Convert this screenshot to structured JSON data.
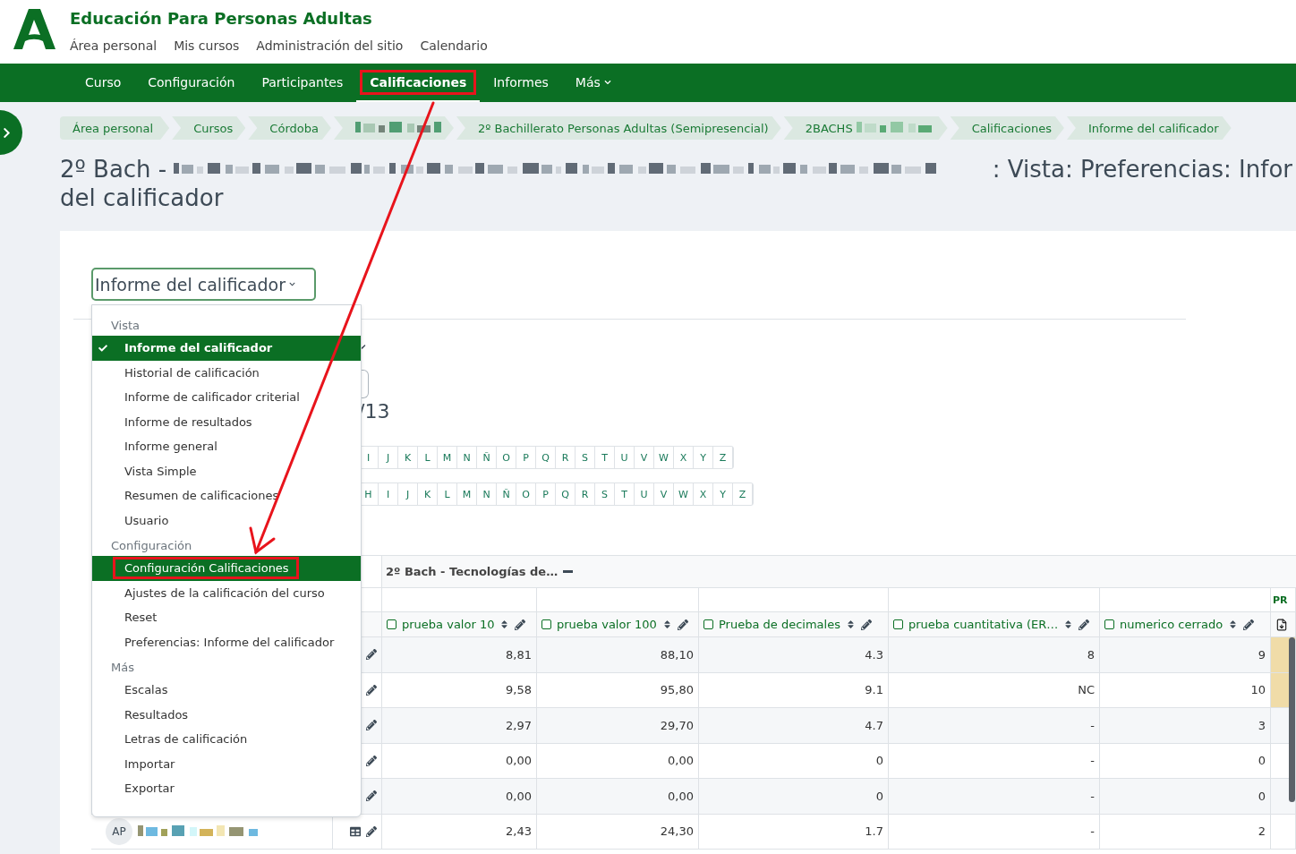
{
  "site": {
    "title": "Educación Para Personas Adultas",
    "nav": [
      "Área personal",
      "Mis cursos",
      "Administración del sitio",
      "Calendario"
    ]
  },
  "course_nav": [
    {
      "label": "Curso",
      "kind": "link",
      "selected": false,
      "highlighted": false
    },
    {
      "label": "Configuración",
      "kind": "link",
      "selected": false,
      "highlighted": false
    },
    {
      "label": "Participantes",
      "kind": "link",
      "selected": false,
      "highlighted": false
    },
    {
      "label": "Calificaciones",
      "kind": "link",
      "selected": true,
      "highlighted": true
    },
    {
      "label": "Informes",
      "kind": "link",
      "selected": false,
      "highlighted": false
    },
    {
      "label": "Más",
      "kind": "menu",
      "selected": false,
      "highlighted": false
    }
  ],
  "breadcrumb": [
    {
      "kind": "text",
      "label": "Área personal"
    },
    {
      "kind": "text",
      "label": "Cursos"
    },
    {
      "kind": "text",
      "label": "Córdoba"
    },
    {
      "kind": "redacted"
    },
    {
      "kind": "text",
      "label": "2º Bachillerato Personas Adultas (Semipresencial)"
    },
    {
      "kind": "partly_redacted",
      "label": "2BACHS"
    },
    {
      "kind": "text",
      "label": "Calificaciones"
    },
    {
      "kind": "text",
      "label": "Informe del calificador"
    }
  ],
  "page_title": {
    "prefix": "2º Bach -",
    "suffix": ": Vista: Preferencias: Infor",
    "line2": "del calificador"
  },
  "report_select": {
    "value": "Informe del calificador",
    "expanded": true
  },
  "menu": [
    {
      "heading": "Vista",
      "items": [
        {
          "label": "Informe del calificador",
          "selected": true,
          "highlighted": false
        },
        {
          "label": "Historial de calificación",
          "selected": false,
          "highlighted": false
        },
        {
          "label": "Informe de calificador criterial",
          "selected": false,
          "highlighted": false
        },
        {
          "label": "Informe de resultados",
          "selected": false,
          "highlighted": false
        },
        {
          "label": "Informe general",
          "selected": false,
          "highlighted": false
        },
        {
          "label": "Vista Simple",
          "selected": false,
          "highlighted": false
        },
        {
          "label": "Resumen de calificaciones",
          "selected": false,
          "highlighted": false
        },
        {
          "label": "Usuario",
          "selected": false,
          "highlighted": false
        }
      ]
    },
    {
      "heading": "Configuración",
      "items": [
        {
          "label": "Configuración Calificaciones",
          "selected": false,
          "highlighted": true
        },
        {
          "label": "Ajustes de la calificación del curso",
          "selected": false,
          "highlighted": false
        },
        {
          "label": "Reset",
          "selected": false,
          "highlighted": false
        },
        {
          "label": "Preferencias: Informe del calificador",
          "selected": false,
          "highlighted": false
        }
      ]
    },
    {
      "heading": "Más",
      "items": [
        {
          "label": "Escalas",
          "selected": false,
          "highlighted": false
        },
        {
          "label": "Resultados",
          "selected": false,
          "highlighted": false
        },
        {
          "label": "Letras de calificación",
          "selected": false,
          "highlighted": false
        },
        {
          "label": "Importar",
          "selected": false,
          "highlighted": false
        },
        {
          "label": "Exportar",
          "selected": false,
          "highlighted": false
        }
      ]
    }
  ],
  "participants_count": "/13",
  "first_name_letters": [
    "I",
    "J",
    "K",
    "L",
    "M",
    "N",
    "Ñ",
    "O",
    "P",
    "Q",
    "R",
    "S",
    "T",
    "U",
    "V",
    "W",
    "X",
    "Y",
    "Z"
  ],
  "last_name_letters": [
    "H",
    "I",
    "J",
    "K",
    "L",
    "M",
    "N",
    "Ñ",
    "O",
    "P",
    "Q",
    "R",
    "S",
    "T",
    "U",
    "V",
    "W",
    "X",
    "Y",
    "Z"
  ],
  "grade_table": {
    "category": "2º Bach - Tecnologías de…",
    "next_column_label": "PR",
    "columns": [
      {
        "label": "prueba valor 10",
        "checked": false
      },
      {
        "label": "prueba valor 100",
        "checked": false
      },
      {
        "label": "Prueba de decimales",
        "checked": false
      },
      {
        "label": "prueba cuantitativa (ER…",
        "checked": false
      },
      {
        "label": "numerico cerrado",
        "checked": false
      }
    ],
    "rows": [
      {
        "kind": "covered",
        "values": [
          "8,81",
          "88,10",
          "4.3",
          "8",
          "9"
        ],
        "last_cell_shaded": true
      },
      {
        "kind": "covered",
        "values": [
          "9,58",
          "95,80",
          "9.1",
          "NC",
          "10"
        ],
        "last_cell_shaded": true
      },
      {
        "kind": "covered",
        "values": [
          "2,97",
          "29,70",
          "4.7",
          "-",
          "3"
        ],
        "last_cell_shaded": false
      },
      {
        "kind": "covered",
        "values": [
          "0,00",
          "0,00",
          "0",
          "-",
          "0"
        ],
        "last_cell_shaded": false
      },
      {
        "kind": "covered",
        "values": [
          "0,00",
          "0,00",
          "0",
          "-",
          "0"
        ],
        "last_cell_shaded": false
      },
      {
        "kind": "full",
        "initials": "AP",
        "values": [
          "2,43",
          "24,30",
          "1.7",
          "-",
          "2"
        ],
        "last_cell_shaded": false
      }
    ]
  }
}
